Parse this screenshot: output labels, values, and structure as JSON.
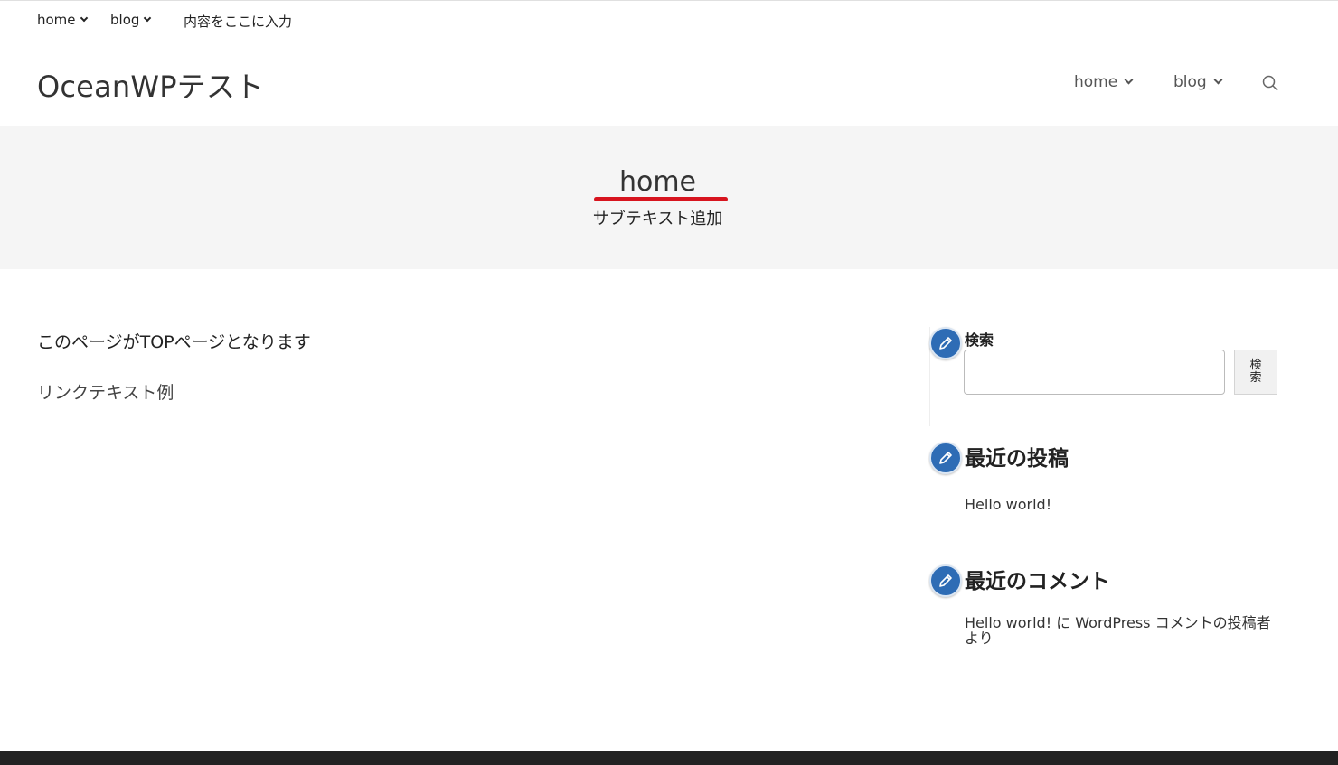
{
  "topbar": {
    "items": [
      {
        "label": "home"
      },
      {
        "label": "blog"
      },
      {
        "label": "内容をここに入力"
      }
    ]
  },
  "header": {
    "site_title": "OceanWPテスト",
    "nav": [
      {
        "label": "home"
      },
      {
        "label": "blog"
      }
    ],
    "search_icon": "search-icon"
  },
  "page_header": {
    "title": "home",
    "subtext": "サブテキスト追加",
    "underline_color": "#d7141e"
  },
  "content": {
    "paragraph": "このページがTOPページとなります",
    "link_text": "リンクテキスト例"
  },
  "sidebar": {
    "search_widget": {
      "title": "検索",
      "input_value": "",
      "button_label": "検索"
    },
    "recent_posts": {
      "title": "最近の投稿",
      "items": [
        "Hello world!"
      ]
    },
    "recent_comments": {
      "title": "最近のコメント",
      "items": [
        "Hello world! に WordPress コメントの投稿者 より"
      ]
    },
    "badge_icon": "pencil-icon",
    "badge_color": "#2e6cb5"
  },
  "footer": {
    "color": "#222222"
  }
}
